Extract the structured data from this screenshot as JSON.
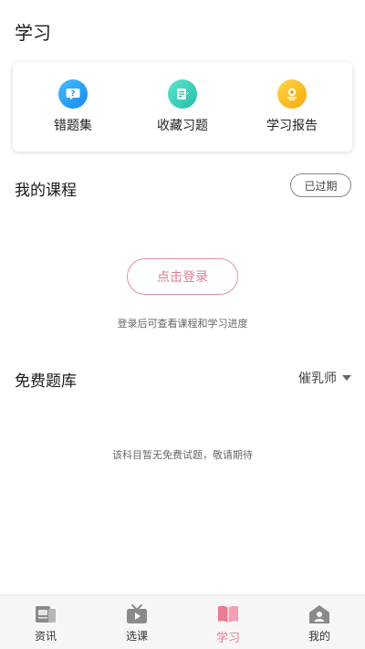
{
  "header": {
    "title": "学习"
  },
  "quick_actions": [
    {
      "label": "错题集",
      "icon": "question-bubble-icon",
      "color": "#1a86ee"
    },
    {
      "label": "收藏习题",
      "icon": "edit-document-icon",
      "color": "#21bfa7"
    },
    {
      "label": "学习报告",
      "icon": "report-badge-icon",
      "color": "#f4a90d"
    }
  ],
  "my_courses": {
    "title": "我的课程",
    "expired_label": "已过期",
    "login_label": "点击登录",
    "hint": "登录后可查看课程和学习进度"
  },
  "free_bank": {
    "title": "免费题库",
    "filter_label": "催乳师",
    "empty_hint": "该科目暂无免费试题，敬请期待"
  },
  "tabbar": {
    "active_color": "#e97b93",
    "items": [
      {
        "label": "资讯",
        "icon": "news-icon"
      },
      {
        "label": "选课",
        "icon": "video-play-icon"
      },
      {
        "label": "学习",
        "icon": "open-book-icon",
        "active": true
      },
      {
        "label": "我的",
        "icon": "profile-house-icon"
      }
    ]
  }
}
